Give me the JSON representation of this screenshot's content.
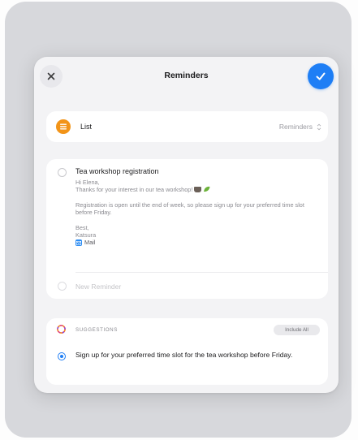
{
  "header": {
    "title": "Reminders",
    "close_icon": "close-icon",
    "done_icon": "checkmark-icon",
    "accent": "#1e7ef5"
  },
  "list_row": {
    "label": "List",
    "value": "Reminders",
    "icon": "list-bullet-icon",
    "icon_color": "#f29418"
  },
  "reminder": {
    "title": "Tea workshop registration",
    "notes": {
      "greeting": "Hi Elena,",
      "line1": "Thanks for your interest in our tea workshop!",
      "paragraph": "Registration is open until the end of week, so please sign up for your preferred time slot before Friday.",
      "signoff": "Best,",
      "sender": "Katsura",
      "source": "Mail"
    }
  },
  "new_reminder_placeholder": "New Reminder",
  "suggestions": {
    "label": "SUGGESTIONS",
    "include_all": "Include All",
    "items": [
      {
        "text": "Sign up for your preferred time slot for the tea workshop before Friday."
      }
    ]
  }
}
